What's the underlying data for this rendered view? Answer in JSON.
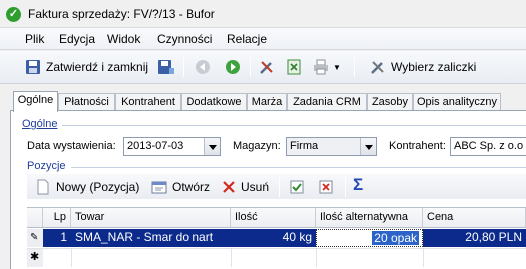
{
  "window": {
    "title": "Faktura sprzedaży: FV/?/13 - Bufor"
  },
  "menu": [
    "Plik",
    "Edycja",
    "Widok",
    "Czynności",
    "Relacje"
  ],
  "toolbar": {
    "save_close_label": "Zatwierdź i zamknij",
    "select_advances_label": "Wybierz zaliczki"
  },
  "tabs": [
    "Ogólne",
    "Płatności",
    "Kontrahent",
    "Dodatkowe",
    "Marża",
    "Zadania CRM",
    "Zasoby",
    "Opis analityczny"
  ],
  "general": {
    "section_title": "Ogólne",
    "issue_date_label": "Data wystawienia:",
    "issue_date_value": "2013-07-03",
    "warehouse_label": "Magazyn:",
    "warehouse_value": "Firma",
    "contractor_label": "Kontrahent:",
    "contractor_value": "ABC Sp. z o.o ("
  },
  "positions": {
    "section_title": "Pozycje",
    "new_label": "Nowy (Pozycja)",
    "open_label": "Otwórz",
    "delete_label": "Usuń",
    "columns": [
      "Lp",
      "Towar",
      "Ilość",
      "Ilość alternatywna",
      "Cena"
    ],
    "rows": [
      {
        "lp": "1",
        "towar": "SMA_NAR - Smar do nart",
        "ilosc": "40 kg",
        "ilosc_alt": "20 opak",
        "cena": "20,80 PLN"
      }
    ]
  },
  "colors": {
    "selection": "#0b2a8c",
    "accent": "#1f3d9c"
  }
}
